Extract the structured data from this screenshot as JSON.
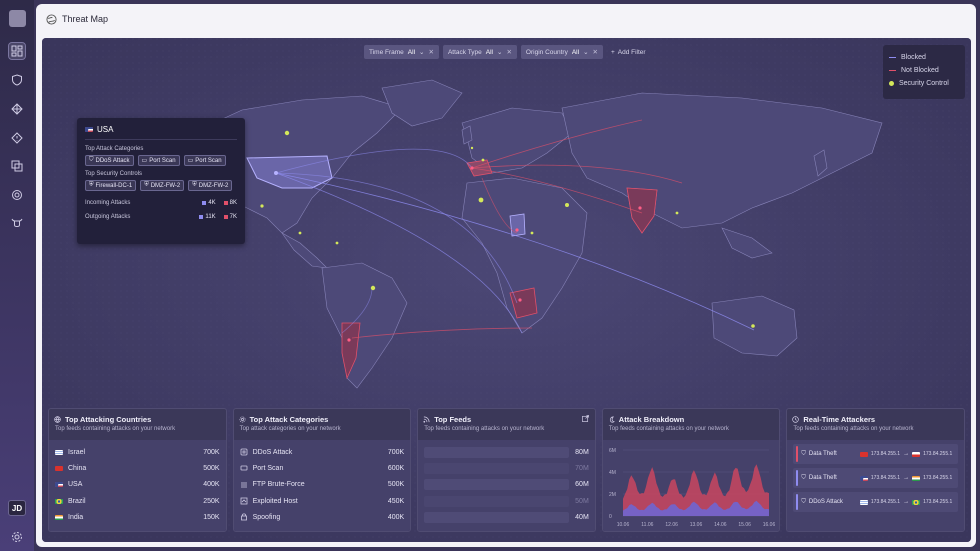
{
  "app": {
    "title": "Threat Map",
    "user_initials": "JD"
  },
  "sidebar": {
    "items": [
      {
        "icon": "dashboard-icon",
        "active": true
      },
      {
        "icon": "shield-icon",
        "active": false
      },
      {
        "icon": "network-icon",
        "active": false
      },
      {
        "icon": "alert-diamond-icon",
        "active": false
      },
      {
        "icon": "copy-icon",
        "active": false
      },
      {
        "icon": "target-icon",
        "active": false
      },
      {
        "icon": "bull-icon",
        "active": false
      }
    ],
    "settings_icon": "settings-icon"
  },
  "filters": [
    {
      "label": "Time Frame",
      "value": "All"
    },
    {
      "label": "Attack Type",
      "value": "All"
    },
    {
      "label": "Origin Country",
      "value": "All"
    }
  ],
  "add_filter": "Add Filter",
  "legend": [
    {
      "label": "Blocked",
      "color": "#8f8cf0",
      "kind": "line"
    },
    {
      "label": "Not Blocked",
      "color": "#e0506a",
      "kind": "line"
    },
    {
      "label": "Security Control",
      "color": "#d4e85a",
      "kind": "dot"
    }
  ],
  "tooltip": {
    "country": "USA",
    "categories_label": "Top Attack Categories",
    "categories": [
      "DDoS Attack",
      "Port Scan",
      "Port Scan"
    ],
    "controls_label": "Top Security Controls",
    "controls": [
      "Firewall-DC-1",
      "DMZ-FW-2",
      "DMZ-FW-2"
    ],
    "incoming_label": "Incoming Attacks",
    "incoming_blocked": "4K",
    "incoming_not_blocked": "8K",
    "outgoing_label": "Outgoing Attacks",
    "outgoing_blocked": "11K",
    "outgoing_not_blocked": "7K"
  },
  "panels": {
    "countries": {
      "title": "Top Attacking Countries",
      "subtitle": "Top feeds containing attacks on your network",
      "rows": [
        {
          "name": "Israel",
          "value": "700K",
          "flag": "il"
        },
        {
          "name": "China",
          "value": "500K",
          "flag": "cn"
        },
        {
          "name": "USA",
          "value": "400K",
          "flag": "us"
        },
        {
          "name": "Brazil",
          "value": "250K",
          "flag": "br"
        },
        {
          "name": "India",
          "value": "150K",
          "flag": "in"
        }
      ]
    },
    "categories": {
      "title": "Top Attack Categories",
      "subtitle": "Top attack categories on your network",
      "rows": [
        {
          "name": "DDoS Attack",
          "value": "700K",
          "icon": "ddos-icon"
        },
        {
          "name": "Port Scan",
          "value": "600K",
          "icon": "port-scan-icon"
        },
        {
          "name": "FTP Brute-Force",
          "value": "500K",
          "icon": "ftp-icon"
        },
        {
          "name": "Exploited Host",
          "value": "450K",
          "icon": "exploit-icon"
        },
        {
          "name": "Spoofing",
          "value": "400K",
          "icon": "spoofing-icon"
        }
      ]
    },
    "feeds": {
      "title": "Top Feeds",
      "subtitle": "Top feeds containing attacks on your network",
      "rows": [
        {
          "value": "80M",
          "dim": false
        },
        {
          "value": "70M",
          "dim": true
        },
        {
          "value": "60M",
          "dim": false
        },
        {
          "value": "50M",
          "dim": true
        },
        {
          "value": "40M",
          "dim": false
        }
      ]
    },
    "breakdown": {
      "title": "Attack Breakdown",
      "subtitle": "Top feeds containing attacks on your network",
      "y_ticks": [
        "6M",
        "4M",
        "2M",
        "0"
      ],
      "x_ticks": [
        "10.06",
        "11.06",
        "12.06",
        "13.06",
        "14.06",
        "15.06",
        "16.06"
      ]
    },
    "attackers": {
      "title": "Real-Time Attackers",
      "subtitle": "Top feeds containing attacks on your network",
      "rows": [
        {
          "type": "Data Theft",
          "src_ip": "173.84.255.1",
          "dst_ip": "173.84.255.1",
          "accent": "#e0506a"
        },
        {
          "type": "Data Theft",
          "src_ip": "173.84.255.1",
          "dst_ip": "173.84.255.1",
          "accent": "#8f8cf0"
        },
        {
          "type": "DDoS Attack",
          "src_ip": "173.84.255.1",
          "dst_ip": "173.84.255.1",
          "accent": "#8f8cf0"
        }
      ]
    }
  },
  "chart_data": {
    "type": "area",
    "title": "Attack Breakdown",
    "x": [
      "10.06",
      "11.06",
      "12.06",
      "13.06",
      "14.06",
      "15.06",
      "16.06"
    ],
    "ylim": [
      0,
      6
    ],
    "series": [
      {
        "name": "Not Blocked",
        "values": [
          3.2,
          4.6,
          3.4,
          4.2,
          3.8,
          4.9,
          4.4
        ]
      },
      {
        "name": "Blocked",
        "values": [
          1.0,
          1.2,
          1.1,
          1.3,
          1.2,
          1.4,
          1.3
        ]
      }
    ]
  }
}
